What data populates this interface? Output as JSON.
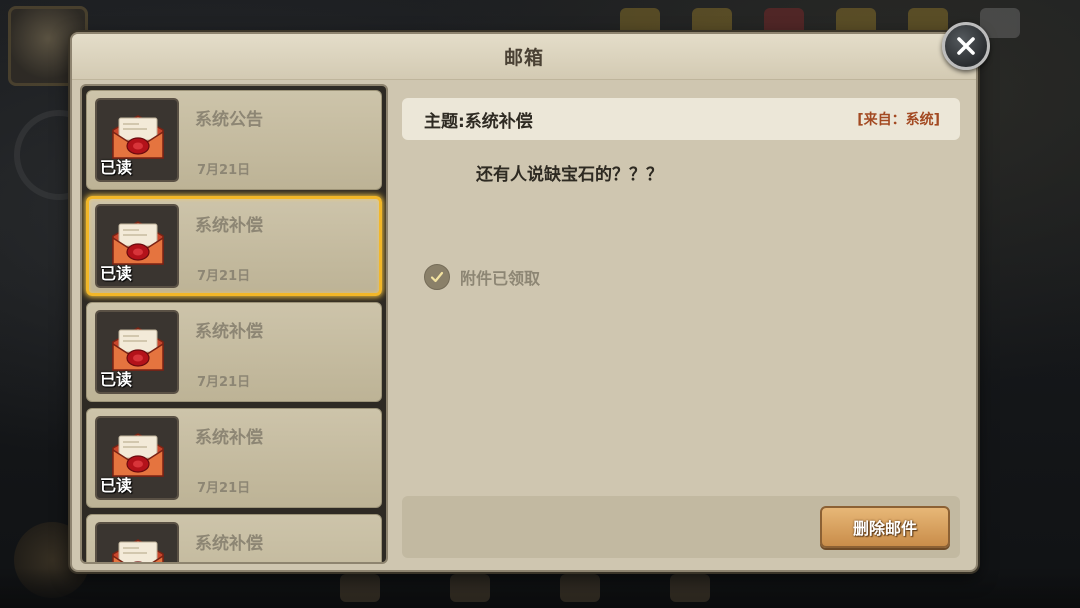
{
  "window": {
    "title": "邮箱"
  },
  "mail_list": [
    {
      "subject": "系统公告",
      "date": "7月21日",
      "status": "已读",
      "selected": false
    },
    {
      "subject": "系统补偿",
      "date": "7月21日",
      "status": "已读",
      "selected": true
    },
    {
      "subject": "系统补偿",
      "date": "7月21日",
      "status": "已读",
      "selected": false
    },
    {
      "subject": "系统补偿",
      "date": "7月21日",
      "status": "已读",
      "selected": false
    },
    {
      "subject": "系统补偿",
      "date": "",
      "status": "",
      "selected": false
    }
  ],
  "detail": {
    "subject": "主题:系统补偿",
    "sender": "[来自：系统]",
    "body": "还有人说缺宝石的？？？",
    "attachment_status": "附件已领取",
    "delete_button": "删除邮件"
  },
  "icons": {
    "close": "close-icon",
    "mail": "envelope-icon",
    "check": "checkmark-icon"
  },
  "colors": {
    "selected_border": "#f2b728",
    "sender_text": "#a34a22",
    "delete_button": "#d9a05c"
  }
}
